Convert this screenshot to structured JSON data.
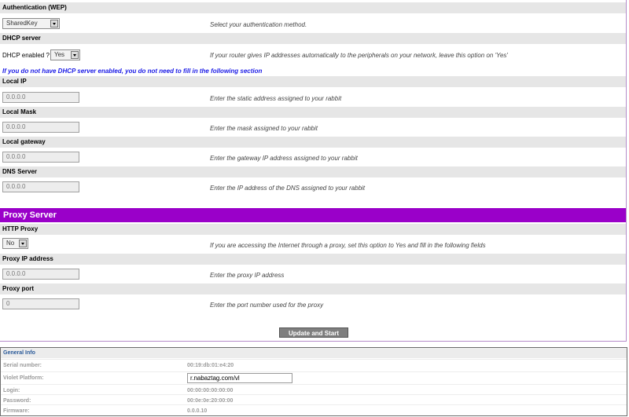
{
  "auth": {
    "header": "Authentication (WEP)",
    "selected": "SharedKey",
    "hint": "Select your authentication method."
  },
  "dhcp": {
    "header": "DHCP server",
    "label": "DHCP enabled ?",
    "selected": "Yes",
    "hint": "If your router gives IP addresses automatically to the peripherals on your network, leave this option on 'Yes'",
    "warning": "If you do not have DHCP server enabled, you do not need to fill in the following section"
  },
  "local_ip": {
    "header": "Local IP",
    "value": "0.0.0.0",
    "hint": "Enter the static address assigned to your rabbit"
  },
  "local_mask": {
    "header": "Local Mask",
    "value": "0.0.0.0",
    "hint": "Enter the mask assigned to your rabbit"
  },
  "local_gateway": {
    "header": "Local gateway",
    "value": "0.0.0.0",
    "hint": "Enter the gateway IP address assigned to your rabbit"
  },
  "dns": {
    "header": "DNS Server",
    "value": "0.0.0.0",
    "hint": "Enter the IP address of the DNS assigned to your rabbit"
  },
  "proxy": {
    "title": "Proxy Server",
    "http_header": "HTTP Proxy",
    "http_selected": "No",
    "http_hint": "If you are accessing the Internet through a proxy, set this option to Yes and fill in the following fields",
    "ip_header": "Proxy IP address",
    "ip_value": "0.0.0.0",
    "ip_hint": "Enter the proxy IP address",
    "port_header": "Proxy port",
    "port_value": "0",
    "port_hint": "Enter the port number used for the proxy"
  },
  "submit_label": "Update and Start",
  "general_info": {
    "title": "General Info",
    "serial_label": "Serial number:",
    "serial_value": "00:19:db:01:e4:20",
    "platform_label": "Violet Platform:",
    "platform_value": "r.nabaztag.com/vl",
    "login_label": "Login:",
    "login_value": "00:00:00:00:00:00",
    "password_label": "Password:",
    "password_value": "00:0e:0e:20:00:00",
    "firmware_label": "Firmware:",
    "firmware_value": "0.0.0.10"
  },
  "colors": {
    "proxy_bar": "#9a00c9",
    "warning_text": "#1a1ae6",
    "panel_border": "#b58bc9",
    "info_title": "#2a5a99"
  }
}
